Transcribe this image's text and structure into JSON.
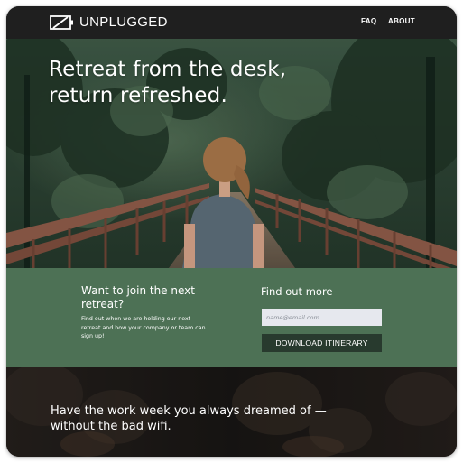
{
  "nav": {
    "logo_text": "UNPLUGGED",
    "links": [
      {
        "label": "FAQ"
      },
      {
        "label": "ABOUT"
      }
    ]
  },
  "hero": {
    "title_line1": "Retreat from the desk,",
    "title_line2": "return refreshed."
  },
  "signup": {
    "join_title": "Want to join the next retreat?",
    "join_body": "Find out when we are holding our next retreat and how your company or team can sign up!",
    "findout_title": "Find out more",
    "email_placeholder": "name@email.com",
    "download_label": "DOWNLOAD ITINERARY"
  },
  "bottom": {
    "text_line1": "Have the work week you always dreamed of —",
    "text_line2": "without the bad wifi."
  },
  "colors": {
    "nav_bg": "#1f1f1f",
    "band_bg": "#4d7155",
    "button_bg": "#283a2e",
    "input_bg": "#e6e8ee"
  }
}
